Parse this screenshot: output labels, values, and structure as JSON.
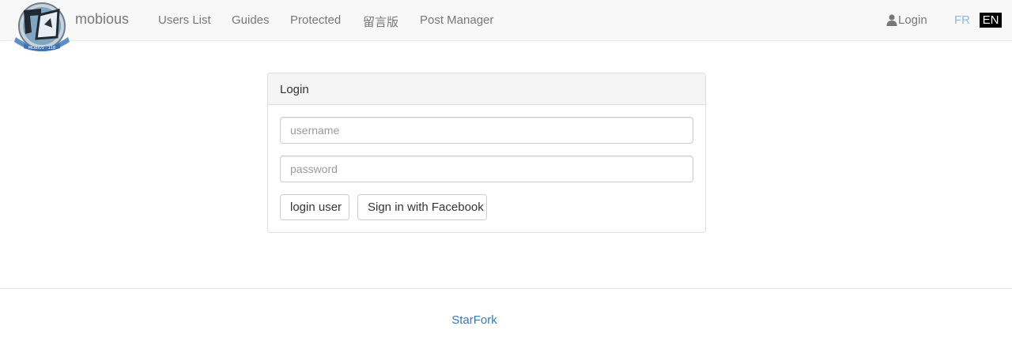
{
  "navbar": {
    "brand": "mobious",
    "logo_text": "MOBIUS · 118",
    "items": [
      {
        "label": "Users List"
      },
      {
        "label": "Guides"
      },
      {
        "label": "Protected"
      },
      {
        "label": "留言版"
      },
      {
        "label": "Post Manager"
      }
    ],
    "login_label": "Login",
    "login_icon": "user-icon",
    "lang_fr": "FR",
    "lang_en": "EN"
  },
  "login_panel": {
    "title": "Login",
    "username_placeholder": "username",
    "password_placeholder": "password",
    "login_button": "login user",
    "facebook_button": "Sign in with Facebook"
  },
  "footer": {
    "link": "StarFork"
  },
  "colors": {
    "navbar_bg": "#f8f8f8",
    "nav_text": "#777777",
    "link_blue": "#337ab7",
    "lang_fr": "#8fb8d8",
    "lang_en_bg": "#000000"
  }
}
